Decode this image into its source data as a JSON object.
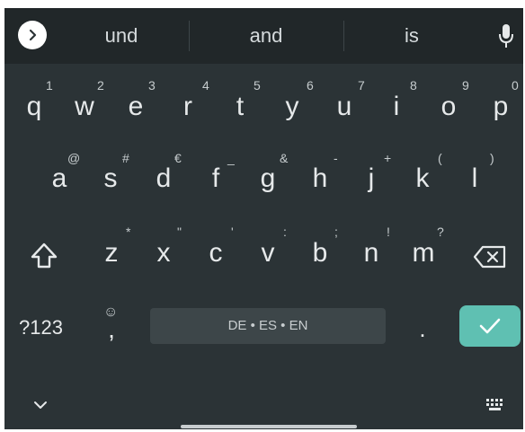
{
  "suggestions": [
    "und",
    "and",
    "is"
  ],
  "row1": [
    {
      "key": "q",
      "hint": "1"
    },
    {
      "key": "w",
      "hint": "2"
    },
    {
      "key": "e",
      "hint": "3"
    },
    {
      "key": "r",
      "hint": "4"
    },
    {
      "key": "t",
      "hint": "5"
    },
    {
      "key": "y",
      "hint": "6"
    },
    {
      "key": "u",
      "hint": "7"
    },
    {
      "key": "i",
      "hint": "8"
    },
    {
      "key": "o",
      "hint": "9"
    },
    {
      "key": "p",
      "hint": "0"
    }
  ],
  "row2": [
    {
      "key": "a",
      "hint": "@"
    },
    {
      "key": "s",
      "hint": "#"
    },
    {
      "key": "d",
      "hint": "€"
    },
    {
      "key": "f",
      "hint": "_"
    },
    {
      "key": "g",
      "hint": "&"
    },
    {
      "key": "h",
      "hint": "-"
    },
    {
      "key": "j",
      "hint": "+"
    },
    {
      "key": "k",
      "hint": "("
    },
    {
      "key": "l",
      "hint": ")"
    }
  ],
  "row3": [
    {
      "key": "z",
      "hint": "*"
    },
    {
      "key": "x",
      "hint": "\""
    },
    {
      "key": "c",
      "hint": "'"
    },
    {
      "key": "v",
      "hint": ":"
    },
    {
      "key": "b",
      "hint": ";"
    },
    {
      "key": "n",
      "hint": "!"
    },
    {
      "key": "m",
      "hint": "?"
    }
  ],
  "bottom": {
    "symbols_label": "?123",
    "comma_key": ",",
    "comma_hint": "☺",
    "space_label": "DE • ES • EN",
    "period_key": "."
  },
  "icons": {
    "expand": "chevron-right-icon",
    "mic": "microphone-icon",
    "shift": "shift-icon",
    "backspace": "backspace-icon",
    "enter": "check-icon",
    "hide": "chevron-down-icon",
    "keyboard": "keyboard-icon"
  },
  "colors": {
    "keyboard_bg": "#2b3336",
    "suggestion_bg": "#212729",
    "key_text": "#e6e9ea",
    "enter_bg": "#5fc0b2",
    "spacebar_bg": "#3d4649"
  }
}
